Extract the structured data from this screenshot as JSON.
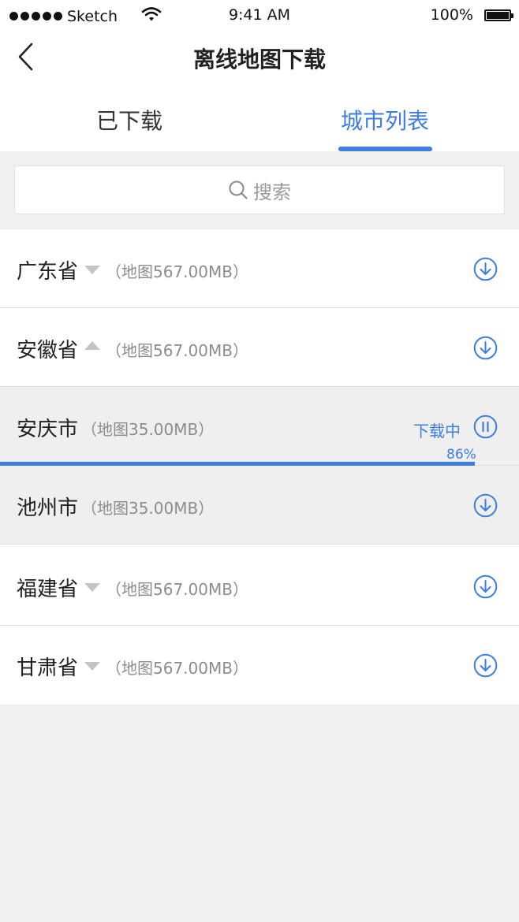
{
  "status_bar": {
    "carrier": "Sketch",
    "time": "9:41 AM",
    "battery": "100%"
  },
  "nav": {
    "title": "离线地图下载"
  },
  "tabs": [
    {
      "label": "已下载",
      "active": false
    },
    {
      "label": "城市列表",
      "active": true
    }
  ],
  "search": {
    "placeholder": "搜索"
  },
  "list": [
    {
      "name": "广东省",
      "size": "（地图567.00MB）",
      "expand": "down",
      "action": "download-icon"
    },
    {
      "name": "安徽省",
      "size": "（地图567.00MB）",
      "expand": "up",
      "action": "download-icon"
    },
    {
      "name": "安庆市",
      "size": "（地图35.00MB）",
      "status": "下载中",
      "progress": 86,
      "progress_text": "86%",
      "action": "pause-icon"
    },
    {
      "name": "池州市",
      "size": "（地图35.00MB）",
      "action": "download-icon"
    },
    {
      "name": "福建省",
      "size": "（地图567.00MB）",
      "expand": "down",
      "action": "download-icon"
    },
    {
      "name": "甘肃省",
      "size": "（地图567.00MB）",
      "expand": "down",
      "action": "download-icon"
    }
  ],
  "colors": {
    "accent": "#3d7ee0",
    "background": "#f0f0f0"
  }
}
